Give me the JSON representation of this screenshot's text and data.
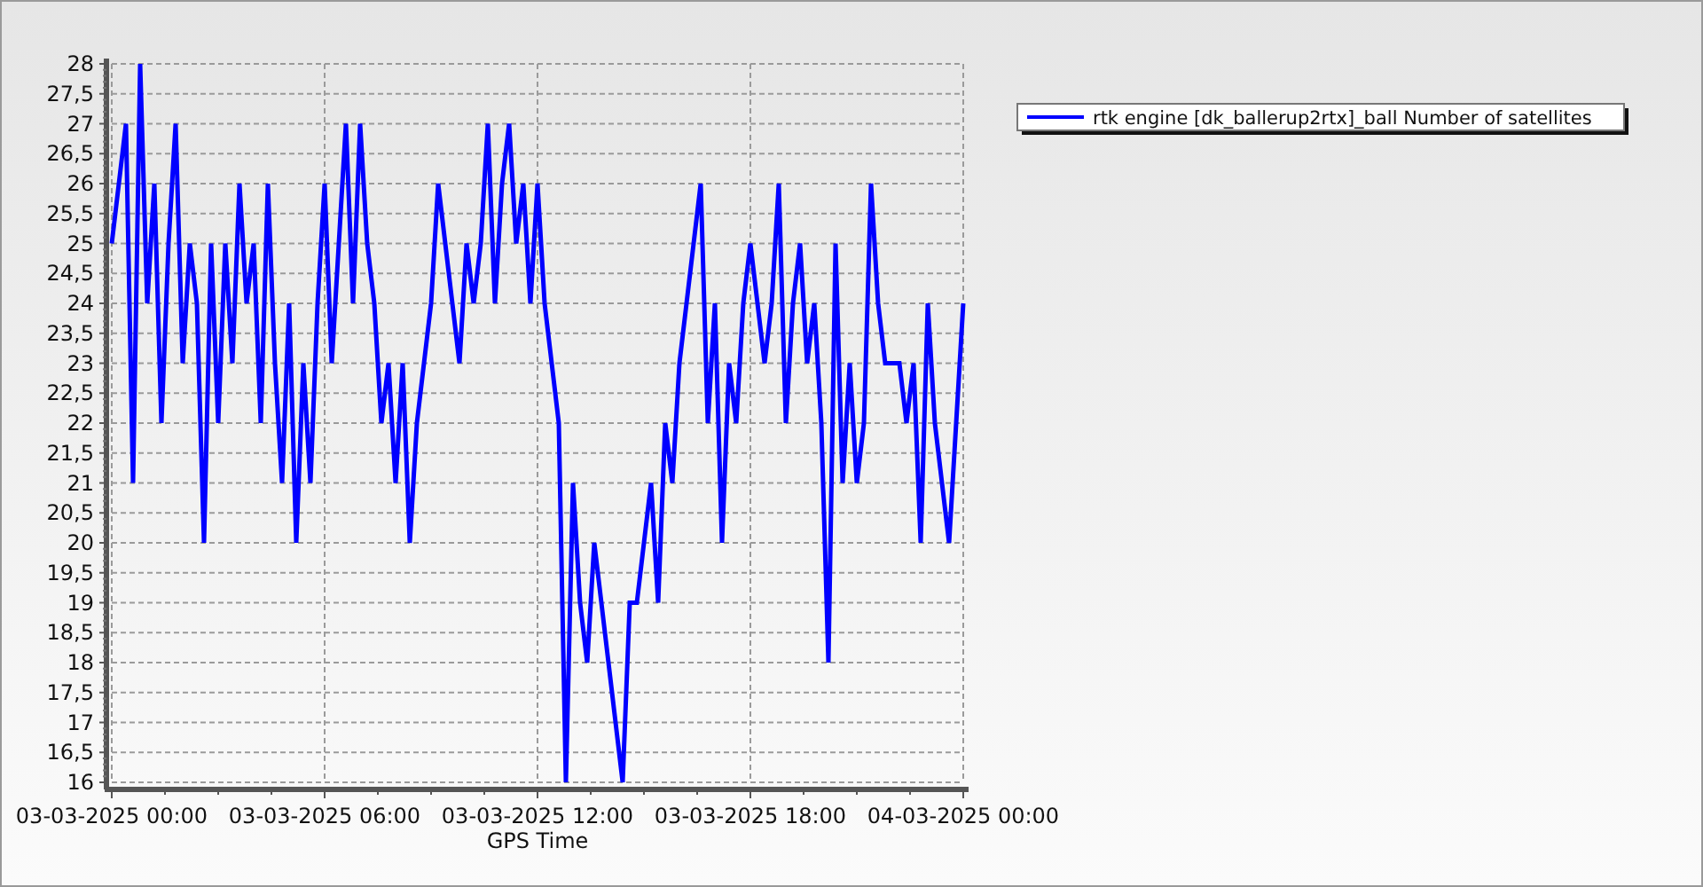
{
  "chart_data": {
    "type": "line",
    "grid": true,
    "xlabel": "GPS Time",
    "categories": [
      "03-03-2025 00:00",
      null,
      null,
      null,
      null,
      null,
      null,
      null,
      null,
      null,
      null,
      null,
      null,
      null,
      null,
      null,
      null,
      null,
      null,
      null,
      null,
      null,
      null,
      null,
      null,
      null,
      null,
      null,
      null,
      null,
      "03-03-2025 06:00",
      null,
      null,
      null,
      null,
      null,
      null,
      null,
      null,
      null,
      null,
      null,
      null,
      null,
      null,
      null,
      null,
      null,
      null,
      null,
      null,
      null,
      null,
      null,
      null,
      null,
      null,
      null,
      null,
      null,
      "03-03-2025 12:00",
      null,
      null,
      null,
      null,
      null,
      null,
      null,
      null,
      null,
      null,
      null,
      null,
      null,
      null,
      null,
      null,
      null,
      null,
      null,
      null,
      null,
      null,
      null,
      null,
      null,
      null,
      null,
      null,
      null,
      "03-03-2025 18:00",
      null,
      null,
      null,
      null,
      null,
      null,
      null,
      null,
      null,
      null,
      null,
      null,
      null,
      null,
      null,
      null,
      null,
      null,
      null,
      null,
      null,
      null,
      null,
      null,
      null,
      null,
      null,
      null,
      null,
      "04-03-2025 00:00"
    ],
    "series": [
      {
        "name": "rtk engine [dk_ballerup2rtx]_ball Number of satellites",
        "color": "#0000ff",
        "values": [
          25,
          26,
          27,
          21,
          28,
          24,
          26,
          22,
          25,
          27,
          23,
          25,
          24,
          20,
          25,
          22,
          25,
          23,
          26,
          24,
          25,
          22,
          26,
          23,
          21,
          24,
          20,
          23,
          21,
          24,
          26,
          23,
          25,
          27,
          24,
          27,
          25,
          24,
          22,
          23,
          21,
          23,
          20,
          22,
          23,
          24,
          26,
          25,
          24,
          23,
          25,
          24,
          25,
          27,
          24,
          26,
          27,
          25,
          26,
          24,
          26,
          24,
          23,
          22,
          16,
          21,
          19,
          18,
          20,
          19,
          18,
          17,
          16,
          19,
          19,
          20,
          21,
          19,
          22,
          21,
          23,
          24,
          25,
          26,
          22,
          24,
          20,
          23,
          22,
          24,
          25,
          24,
          23,
          24,
          26,
          22,
          24,
          25,
          23,
          24,
          22,
          18,
          25,
          21,
          23,
          21,
          22,
          26,
          24,
          23,
          23,
          23,
          22,
          23,
          20,
          24,
          22,
          21,
          20,
          22,
          24
        ]
      }
    ],
    "ylim": [
      16,
      28
    ],
    "yticks": [
      16,
      {
        "value": 16.5,
        "label": "16,5"
      },
      17,
      {
        "value": 17.5,
        "label": "17,5"
      },
      18,
      {
        "value": 18.5,
        "label": "18,5"
      },
      19,
      {
        "value": 19.5,
        "label": "19,5"
      },
      20,
      {
        "value": 20.5,
        "label": "20,5"
      },
      21,
      {
        "value": 21.5,
        "label": "21,5"
      },
      22,
      {
        "value": 22.5,
        "label": "22,5"
      },
      23,
      {
        "value": 23.5,
        "label": "23,5"
      },
      24,
      {
        "value": 24.5,
        "label": "24,5"
      },
      25,
      {
        "value": 25.5,
        "label": "25,5"
      },
      26,
      {
        "value": 26.5,
        "label": "26,5"
      },
      27,
      {
        "value": 27.5,
        "label": "27,5"
      },
      28
    ]
  }
}
